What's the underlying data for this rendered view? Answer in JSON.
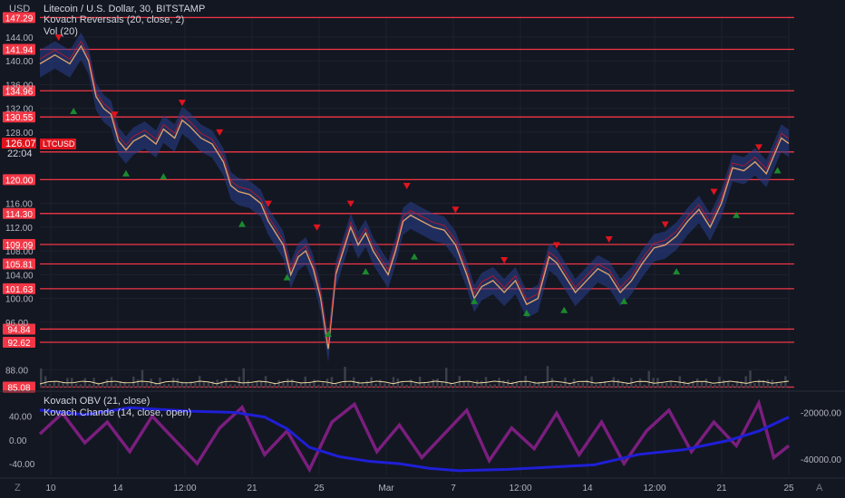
{
  "header": {
    "currency": "USD",
    "title": "Litecoin / U.S. Dollar, 30, BITSTAMP",
    "indicator1": "Kovach Reversals (20, close, 2)",
    "indicator2": "Vol (20)"
  },
  "lower_panel": {
    "indicator1": "Kovach OBV (21, close)",
    "indicator2": "Kovach Chande (14, close, open)"
  },
  "symbol_tag": "LTCUSD",
  "current_price": "126.07",
  "countdown": "22:04",
  "footer": {
    "left_icon": "Z",
    "right_icon": "A"
  },
  "colors": {
    "background": "#131722",
    "level_line": "#f23645",
    "up_marker": "#1b8a2e",
    "down_marker": "#e0141e",
    "band": "#2a3f8f",
    "obv": "#1f1fd6",
    "chande": "#7b1e7e"
  },
  "chart_data": [
    {
      "type": "line",
      "title": "Litecoin / U.S. Dollar, 30, BITSTAMP",
      "series_name": "LTCUSD",
      "y_ticks": [
        "144.00",
        "140.00",
        "136.00",
        "132.00",
        "128.00",
        "116.00",
        "112.00",
        "108.00",
        "104.00",
        "100.00",
        "96.00",
        "88.00"
      ],
      "ylim": [
        85,
        147.5
      ],
      "x_ticks": [
        "10",
        "14",
        "12:00",
        "21",
        "25",
        "Mar",
        "7",
        "12:00",
        "14",
        "12:00",
        "21",
        "25"
      ],
      "horizontal_levels": [
        "147.29",
        "141.94",
        "134.96",
        "130.55",
        "124.66",
        "120.00",
        "114.30",
        "109.09",
        "105.81",
        "101.63",
        "94.84",
        "92.62",
        "85.08"
      ],
      "price_path": [
        [
          0.0,
          139.5
        ],
        [
          0.02,
          141.0
        ],
        [
          0.04,
          139.5
        ],
        [
          0.055,
          142.5
        ],
        [
          0.065,
          140.0
        ],
        [
          0.075,
          134.0
        ],
        [
          0.085,
          132.0
        ],
        [
          0.095,
          131.0
        ],
        [
          0.105,
          126.5
        ],
        [
          0.115,
          125.0
        ],
        [
          0.125,
          126.5
        ],
        [
          0.14,
          127.5
        ],
        [
          0.155,
          126.0
        ],
        [
          0.165,
          128.5
        ],
        [
          0.18,
          127.0
        ],
        [
          0.19,
          130.0
        ],
        [
          0.2,
          129.0
        ],
        [
          0.215,
          127.0
        ],
        [
          0.23,
          126.0
        ],
        [
          0.245,
          123.0
        ],
        [
          0.255,
          119.0
        ],
        [
          0.265,
          118.0
        ],
        [
          0.28,
          117.5
        ],
        [
          0.295,
          116.0
        ],
        [
          0.305,
          113.0
        ],
        [
          0.315,
          111.0
        ],
        [
          0.325,
          109.0
        ],
        [
          0.335,
          104.0
        ],
        [
          0.345,
          107.0
        ],
        [
          0.355,
          108.0
        ],
        [
          0.365,
          105.0
        ],
        [
          0.375,
          100.0
        ],
        [
          0.385,
          91.5
        ],
        [
          0.395,
          104.0
        ],
        [
          0.405,
          108.0
        ],
        [
          0.415,
          112.0
        ],
        [
          0.425,
          109.0
        ],
        [
          0.435,
          111.0
        ],
        [
          0.445,
          108.0
        ],
        [
          0.455,
          106.0
        ],
        [
          0.465,
          104.0
        ],
        [
          0.475,
          108.0
        ],
        [
          0.485,
          113.0
        ],
        [
          0.495,
          114.0
        ],
        [
          0.51,
          113.0
        ],
        [
          0.525,
          112.0
        ],
        [
          0.54,
          111.5
        ],
        [
          0.555,
          109.0
        ],
        [
          0.57,
          104.0
        ],
        [
          0.58,
          100.0
        ],
        [
          0.59,
          102.0
        ],
        [
          0.605,
          103.0
        ],
        [
          0.62,
          101.0
        ],
        [
          0.635,
          103.0
        ],
        [
          0.65,
          99.0
        ],
        [
          0.665,
          100.0
        ],
        [
          0.68,
          107.0
        ],
        [
          0.69,
          106.0
        ],
        [
          0.7,
          104.0
        ],
        [
          0.715,
          101.0
        ],
        [
          0.73,
          103.0
        ],
        [
          0.745,
          105.0
        ],
        [
          0.76,
          104.0
        ],
        [
          0.775,
          101.0
        ],
        [
          0.79,
          103.0
        ],
        [
          0.805,
          106.0
        ],
        [
          0.82,
          108.5
        ],
        [
          0.835,
          109.0
        ],
        [
          0.85,
          110.5
        ],
        [
          0.865,
          113.0
        ],
        [
          0.88,
          115.0
        ],
        [
          0.895,
          112.0
        ],
        [
          0.91,
          116.0
        ],
        [
          0.925,
          122.0
        ],
        [
          0.94,
          121.5
        ],
        [
          0.955,
          123.0
        ],
        [
          0.97,
          121.0
        ],
        [
          0.98,
          124.0
        ],
        [
          0.99,
          127.0
        ],
        [
          1.0,
          126.1
        ]
      ],
      "reversals_up": [
        [
          0.045,
          131.5
        ],
        [
          0.115,
          121.0
        ],
        [
          0.165,
          120.5
        ],
        [
          0.27,
          112.5
        ],
        [
          0.33,
          103.5
        ],
        [
          0.385,
          94.0
        ],
        [
          0.435,
          104.5
        ],
        [
          0.5,
          107.0
        ],
        [
          0.58,
          99.5
        ],
        [
          0.65,
          97.5
        ],
        [
          0.7,
          98.0
        ],
        [
          0.78,
          99.5
        ],
        [
          0.85,
          104.5
        ],
        [
          0.93,
          114.0
        ],
        [
          0.985,
          121.5
        ]
      ],
      "reversals_down": [
        [
          0.025,
          144.0
        ],
        [
          0.1,
          131.0
        ],
        [
          0.19,
          133.0
        ],
        [
          0.24,
          128.0
        ],
        [
          0.305,
          116.0
        ],
        [
          0.37,
          112.0
        ],
        [
          0.415,
          116.0
        ],
        [
          0.49,
          119.0
        ],
        [
          0.555,
          115.0
        ],
        [
          0.62,
          106.5
        ],
        [
          0.69,
          109.0
        ],
        [
          0.76,
          110.0
        ],
        [
          0.835,
          112.5
        ],
        [
          0.9,
          118.0
        ],
        [
          0.96,
          125.5
        ]
      ]
    },
    {
      "type": "line",
      "series": [
        {
          "name": "Kovach OBV (21, close)",
          "axis": "right",
          "ylim": [
            -47000,
            -14000
          ],
          "points": [
            [
              0.0,
              -19000
            ],
            [
              0.06,
              -21000
            ],
            [
              0.12,
              -18000
            ],
            [
              0.2,
              -19500
            ],
            [
              0.26,
              -20000
            ],
            [
              0.3,
              -22000
            ],
            [
              0.33,
              -27000
            ],
            [
              0.36,
              -35000
            ],
            [
              0.4,
              -39000
            ],
            [
              0.44,
              -41000
            ],
            [
              0.48,
              -42000
            ],
            [
              0.52,
              -44000
            ],
            [
              0.56,
              -45000
            ],
            [
              0.62,
              -44500
            ],
            [
              0.68,
              -43500
            ],
            [
              0.74,
              -42500
            ],
            [
              0.8,
              -38000
            ],
            [
              0.86,
              -36000
            ],
            [
              0.92,
              -32000
            ],
            [
              0.96,
              -28000
            ],
            [
              1.0,
              -22000
            ]
          ]
        },
        {
          "name": "Kovach Chande (14, close, open)",
          "axis": "left",
          "ylim": [
            -60,
            70
          ],
          "points": [
            [
              0.0,
              10
            ],
            [
              0.03,
              45
            ],
            [
              0.06,
              -5
            ],
            [
              0.09,
              30
            ],
            [
              0.12,
              -20
            ],
            [
              0.15,
              40
            ],
            [
              0.18,
              0
            ],
            [
              0.21,
              -40
            ],
            [
              0.24,
              20
            ],
            [
              0.27,
              55
            ],
            [
              0.3,
              -25
            ],
            [
              0.33,
              15
            ],
            [
              0.36,
              -50
            ],
            [
              0.39,
              30
            ],
            [
              0.42,
              60
            ],
            [
              0.45,
              -20
            ],
            [
              0.48,
              25
            ],
            [
              0.51,
              -30
            ],
            [
              0.54,
              10
            ],
            [
              0.57,
              50
            ],
            [
              0.6,
              -35
            ],
            [
              0.63,
              20
            ],
            [
              0.66,
              -15
            ],
            [
              0.69,
              45
            ],
            [
              0.72,
              -25
            ],
            [
              0.75,
              30
            ],
            [
              0.78,
              -40
            ],
            [
              0.81,
              15
            ],
            [
              0.84,
              50
            ],
            [
              0.87,
              -20
            ],
            [
              0.9,
              30
            ],
            [
              0.93,
              -10
            ],
            [
              0.96,
              62
            ],
            [
              0.98,
              -30
            ],
            [
              1.0,
              -10
            ]
          ]
        }
      ],
      "left_ticks": [
        "40.00",
        "0.00",
        "-40.00"
      ],
      "right_ticks": [
        "-20000.00",
        "-40000.00"
      ]
    }
  ]
}
